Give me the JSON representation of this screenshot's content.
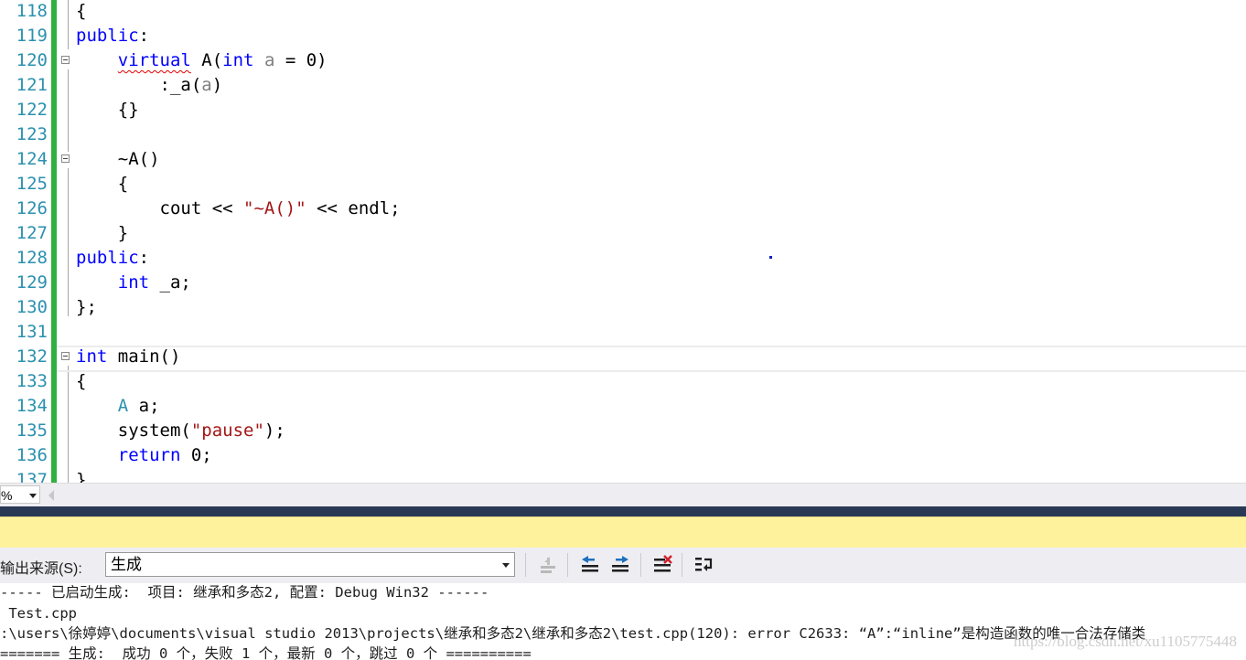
{
  "editor": {
    "lines": [
      {
        "n": "118",
        "html": "{"
      },
      {
        "n": "119",
        "html": "<span class='kw'>public</span>:"
      },
      {
        "n": "120",
        "html": "    <span class='kw squig'>virtual</span> A(<span class='kw'>int</span> <span class='gr'>a</span> = 0)",
        "fold": true
      },
      {
        "n": "121",
        "html": "        :_a(<span class='gr'>a</span>)"
      },
      {
        "n": "122",
        "html": "    {}"
      },
      {
        "n": "123",
        "html": ""
      },
      {
        "n": "124",
        "html": "    ~A()",
        "fold": true
      },
      {
        "n": "125",
        "html": "    {"
      },
      {
        "n": "126",
        "html": "        cout &lt;&lt; <span class='str'>\"~A()\"</span> &lt;&lt; endl;"
      },
      {
        "n": "127",
        "html": "    }"
      },
      {
        "n": "128",
        "html": "<span class='kw'>public</span>:"
      },
      {
        "n": "129",
        "html": "    <span class='kw'>int</span> _a;"
      },
      {
        "n": "130",
        "html": "};"
      },
      {
        "n": "131",
        "html": ""
      },
      {
        "n": "132",
        "html": "<span class='kw'>int</span> main()",
        "fold": true
      },
      {
        "n": "133",
        "html": "{"
      },
      {
        "n": "134",
        "html": "    <span class='ty'>A</span> a;"
      },
      {
        "n": "135",
        "html": "    system(<span class='str'>\"pause\"</span>);"
      },
      {
        "n": "136",
        "html": "    <span class='kw'>return</span> 0;"
      },
      {
        "n": "137",
        "html": "}"
      }
    ]
  },
  "zoom": {
    "value": "%"
  },
  "output": {
    "source_label": "输出来源(S):",
    "source_value": "生成",
    "lines": [
      "----- 已启动生成:  项目: 继承和多态2, 配置: Debug Win32 ------",
      " Test.cpp",
      ":\\users\\徐婷婷\\documents\\visual studio 2013\\projects\\继承和多态2\\继承和多态2\\test.cpp(120): error C2633: “A”:“inline”是构造函数的唯一合法存储类",
      "======= 生成:  成功 0 个，失败 1 个，最新 0 个，跳过 0 个 =========="
    ],
    "watermark": "https://blog.csdn.net/xu1105775448"
  },
  "colors": {
    "keyword": "#0000ff",
    "type": "#2b91af",
    "string": "#a31515",
    "change_bar": "#2fb040",
    "notify_bar": "#fff29d"
  }
}
